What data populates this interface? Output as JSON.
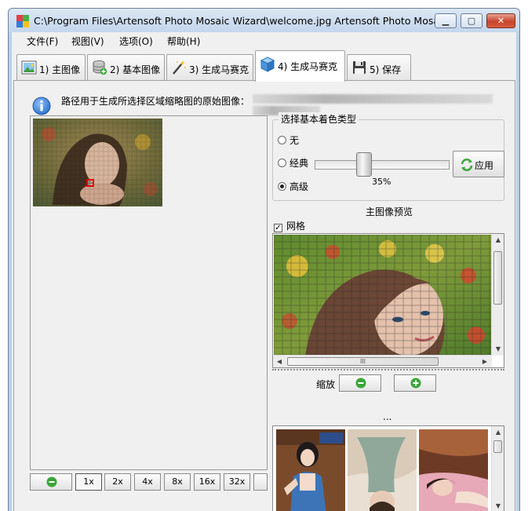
{
  "window": {
    "title": "C:\\Program Files\\Artensoft Photo Mosaic Wizard\\welcome.jpg Artensoft Photo Mosaic...",
    "controls": {
      "minimize": "▁",
      "maximize": "▢",
      "close": "✕"
    }
  },
  "menu": [
    "文件(F)",
    "视图(V)",
    "选项(O)",
    "帮助(H)"
  ],
  "tabs": [
    {
      "label": "1) 主图像",
      "icon": "image-icon"
    },
    {
      "label": "2) 基本图像",
      "icon": "database-add-icon"
    },
    {
      "label": "3) 生成马赛克",
      "icon": "magic-wand-icon"
    },
    {
      "label": "4) 生成马赛克",
      "icon": "cube-icon",
      "active": true
    },
    {
      "label": "5) 保存",
      "icon": "floppy-disk-icon"
    }
  ],
  "info": {
    "text": "路径用于生成所选择区域缩略图的原始图像："
  },
  "left_zoom": {
    "buttons": [
      "1x",
      "2x",
      "4x",
      "8x",
      "16x",
      "32x"
    ],
    "selected": "1x"
  },
  "color_type": {
    "title": "选择基本着色类型",
    "options": [
      "无",
      "经典",
      "高级"
    ],
    "selected": "高级",
    "slider_percent": 35,
    "slider_label": "35%",
    "apply_label": "应用"
  },
  "preview": {
    "title": "主图像预览",
    "grid_label": "网格",
    "grid_checked": true,
    "check_mark": "✓",
    "hscroll_grip": "III",
    "zoom_label": "缩放",
    "ellipsis": "..."
  },
  "colors": {
    "accent_green": "#3aa63a",
    "info_blue": "#2a6fcb",
    "marker_red": "#e00000"
  }
}
